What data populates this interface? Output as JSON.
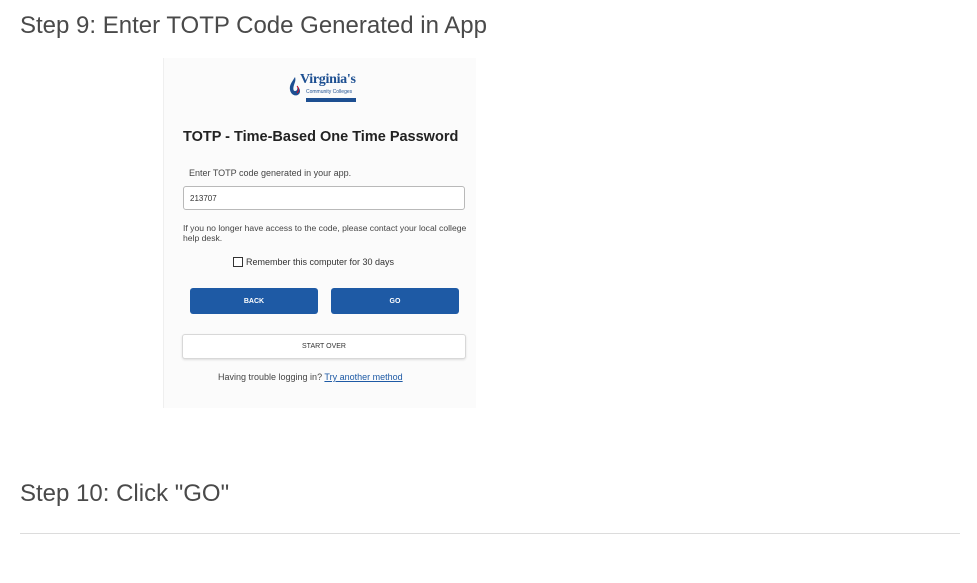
{
  "article": {
    "step9_heading": "Step 9: Enter TOTP Code Generated in App",
    "step10_heading": "Step 10: Click \"GO\""
  },
  "screenshot": {
    "logo": {
      "wordmark": "Virginia's",
      "subtitle": "Community Colleges",
      "brand_color": "#1d4f91"
    },
    "title": "TOTP - Time-Based One Time Password",
    "instruction": "Enter TOTP code generated in your app.",
    "code_value": "213707",
    "help_text": "If you no longer have access to the code, please contact your local college help desk.",
    "remember_label": "Remember this computer for 30 days",
    "remember_checked": false,
    "back_label": "BACK",
    "go_label": "GO",
    "start_over_label": "START OVER",
    "trouble_text": "Having trouble logging in?",
    "try_another_link": "Try another method",
    "button_color": "#1e5aa5"
  }
}
